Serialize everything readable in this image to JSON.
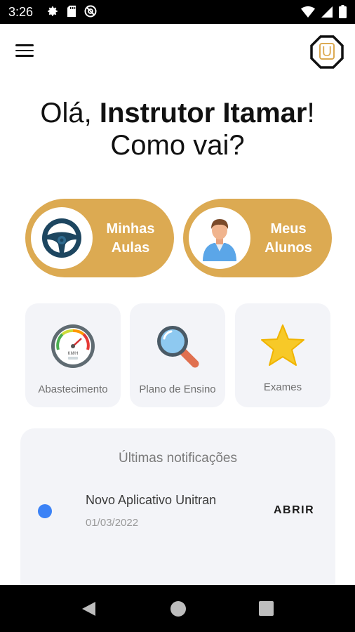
{
  "status_bar": {
    "time": "3:26",
    "icons": [
      "gear-icon",
      "sd-card-icon",
      "no-disturb-icon",
      "wifi-icon",
      "signal-icon",
      "battery-icon"
    ]
  },
  "app_bar": {
    "menu_icon": "hamburger-menu-icon",
    "logo_letter": "U",
    "logo_colors": {
      "outline": "#111111",
      "accent": "#dcaa52"
    }
  },
  "greeting": {
    "prefix": "Olá, ",
    "name": "Instrutor Itamar",
    "suffix": "!",
    "line2": "Como vai?"
  },
  "main_cards": [
    {
      "line1": "Minhas",
      "line2": "Aulas",
      "icon": "steering-wheel-icon"
    },
    {
      "line1": "Meus",
      "line2": "Alunos",
      "icon": "student-avatar-icon"
    }
  ],
  "shortcut_cards": [
    {
      "label": "Abastecimento",
      "icon": "speedometer-gauge-icon",
      "gauge_text": "KM/H"
    },
    {
      "label": "Plano de Ensino",
      "icon": "magnifier-icon"
    },
    {
      "label": "Exames",
      "icon": "star-icon"
    }
  ],
  "notifications": {
    "title": "Últimas notificações",
    "items": [
      {
        "title": "Novo Aplicativo Unitran",
        "date": "01/03/2022",
        "action": "ABRIR",
        "unread_color": "#3b82f6"
      }
    ]
  },
  "nav_bar": {
    "buttons": [
      "back-icon",
      "home-icon",
      "recent-apps-icon"
    ]
  },
  "colors": {
    "accent": "#dcaa52",
    "card_background": "#f3f4f8",
    "unread_dot": "#3b82f6"
  }
}
